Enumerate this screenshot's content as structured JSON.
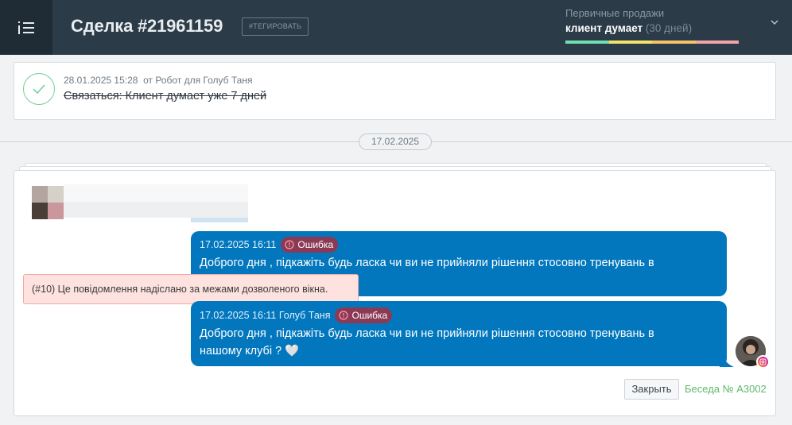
{
  "header": {
    "title": "Сделка #21961159",
    "tag_button": "#ТЕГИРОВАТЬ",
    "pipeline": "Первичные продажи",
    "stage": "клиент думает",
    "stage_days": "(30 дней)",
    "progress_colors": [
      "#6fe0b0",
      "#f3e26b",
      "#f6c46a",
      "#f2a4a8"
    ]
  },
  "task": {
    "meta": "28.01.2025 15:28  от Робот для Голуб Таня",
    "text": "Связаться: Клиент думает уже 7 дней"
  },
  "date_divider": "17.02.2025",
  "messages": [
    {
      "meta": "17.02.2025 16:11",
      "status": "Ошибка",
      "text": "Доброго дня , підкажіть будь ласка чи ви не прийняли рішення стосовно тренувань в"
    },
    {
      "meta": "17.02.2025 16:11 Голуб Таня",
      "status": "Ошибка",
      "text_line1": "Доброго дня , підкажіть будь ласка чи ви не прийняли рішення стосовно тренувань в",
      "text_line2": "нашому клубі ? 🤍"
    }
  ],
  "error_tooltip": "(#10) Це повідомлення надіслано за межами дозволеного вікна.",
  "footer": {
    "close_label": "Закрыть",
    "conversation_label": "Беседа № A3002"
  },
  "colors": {
    "header_bg": "#2b3b47",
    "bubble_bg": "#0277bd",
    "error_badge": "#8b3a56",
    "accent_green": "#5eb86e"
  }
}
